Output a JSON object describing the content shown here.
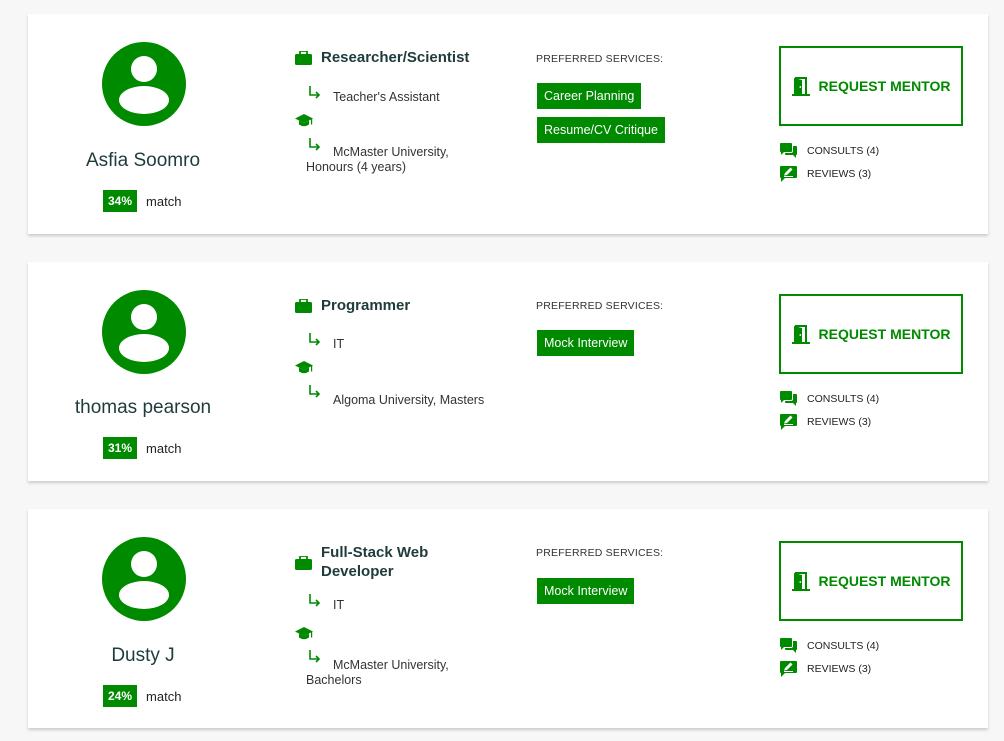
{
  "colors": {
    "accent": "#008a00",
    "card_bg": "#ffffff",
    "page_bg": "#f7f7f7",
    "name_text": "#1f3b3b"
  },
  "icons": {
    "avatar": "user-avatar-icon",
    "job": "briefcase-icon",
    "sub": "arrow-turn-down-right-icon",
    "education": "graduation-cap-icon",
    "request": "door-open-icon",
    "consults": "chat-bubbles-icon",
    "reviews": "edit-pencil-icon"
  },
  "labels": {
    "match": "match",
    "preferred_services": "PREFERRED SERVICES:",
    "request_mentor": "REQUEST MENTOR"
  },
  "mentors": [
    {
      "name": "Asfia Soomro",
      "match_percent": "34%",
      "job_title": "Researcher/Scientist",
      "job_sub": "Teacher's Assistant",
      "school": "McMaster University, Honours (4 years)",
      "services": [
        "Career Planning",
        "Resume/CV Critique"
      ],
      "consults": "CONSULTS (4)",
      "reviews": "REVIEWS (3)"
    },
    {
      "name": "thomas pearson",
      "match_percent": "31%",
      "job_title": "Programmer",
      "job_sub": "IT",
      "school": "Algoma University, Masters",
      "services": [
        "Mock Interview"
      ],
      "consults": "CONSULTS (4)",
      "reviews": "REVIEWS (3)"
    },
    {
      "name": "Dusty J",
      "match_percent": "24%",
      "job_title": "Full-Stack Web Developer",
      "job_sub": "IT",
      "school": "McMaster University, Bachelors",
      "services": [
        "Mock Interview"
      ],
      "consults": "CONSULTS (4)",
      "reviews": "REVIEWS (3)"
    }
  ]
}
